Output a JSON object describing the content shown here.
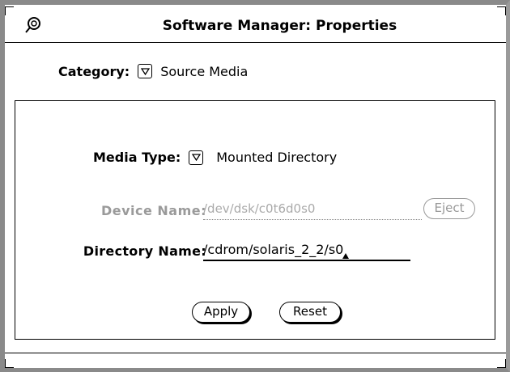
{
  "window": {
    "title": "Software Manager: Properties",
    "pin_icon": "pushpin-icon"
  },
  "category": {
    "label": "Category:",
    "value": "Source Media",
    "menu_icon": "menu-triangle-icon"
  },
  "media": {
    "label": "Media Type:",
    "value": "Mounted Directory",
    "menu_icon": "menu-triangle-icon"
  },
  "device": {
    "label": "Device Name:",
    "value": "/dev/dsk/c0t6d0s0",
    "eject_label": "Eject",
    "enabled": false
  },
  "directory": {
    "label": "Directory Name:",
    "value": "/cdrom/solaris_2_2/s0"
  },
  "buttons": {
    "apply": "Apply",
    "reset": "Reset"
  }
}
